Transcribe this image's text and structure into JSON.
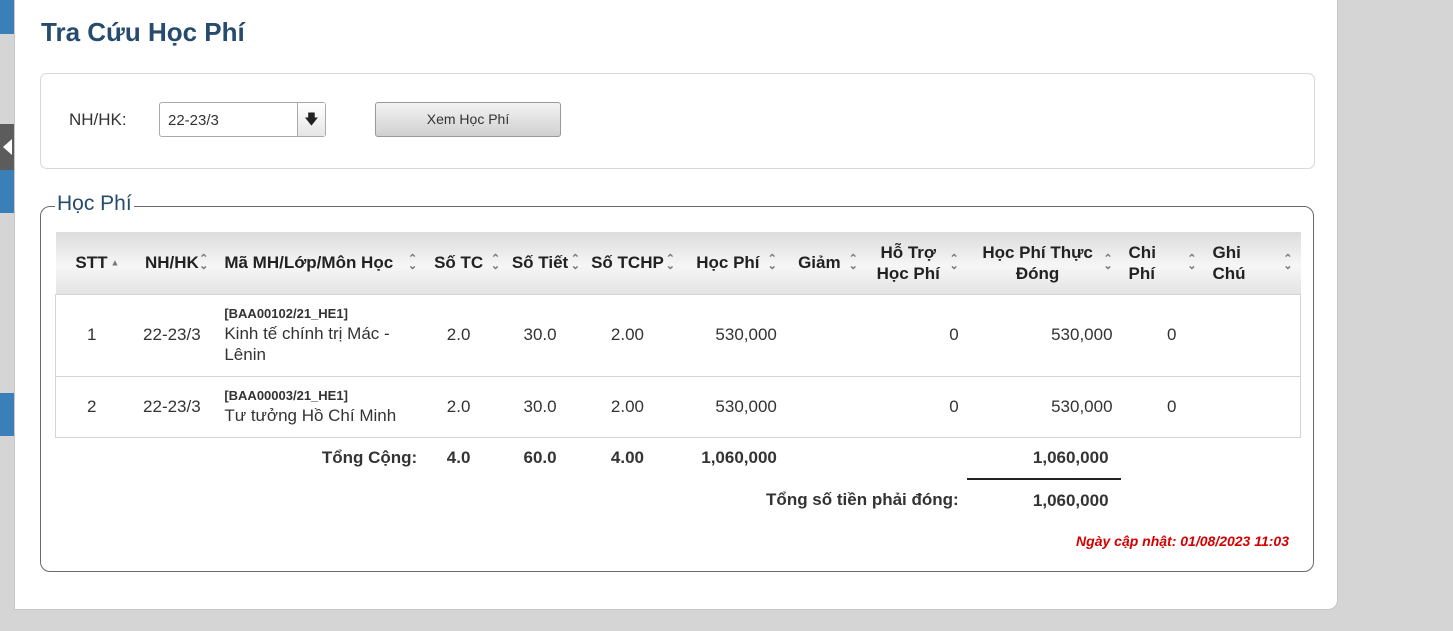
{
  "page": {
    "title": "Tra Cứu Học Phí"
  },
  "filter": {
    "term_label": "NH/HK:",
    "term_value": "22-23/3",
    "view_button_label": "Xem Học Phí"
  },
  "fees": {
    "legend": "Học Phí",
    "columns": [
      {
        "label": "STT",
        "sort": "▲"
      },
      {
        "label": "NH/HK",
        "sort": "⌃⌄"
      },
      {
        "label": "Mã MH/Lớp/Môn Học",
        "sort": "⌃⌄"
      },
      {
        "label": "Số TC",
        "sort": "⌃⌄"
      },
      {
        "label": "Số Tiết",
        "sort": "⌃⌄"
      },
      {
        "label": "Số TCHP",
        "sort": "⌃⌄"
      },
      {
        "label": "Học Phí",
        "sort": "⌃⌄"
      },
      {
        "label": "Giảm",
        "sort": "⌃⌄"
      },
      {
        "label": "Hỗ Trợ Học Phí",
        "sort": "⌃⌄"
      },
      {
        "label": "Học Phí Thực Đóng",
        "sort": "⌃⌄"
      },
      {
        "label": "Chi Phí",
        "sort": "⌃⌄"
      },
      {
        "label": "Ghi Chú",
        "sort": "⌃⌄"
      }
    ],
    "rows": [
      {
        "stt": "1",
        "term": "22-23/3",
        "code": "[BAA00102/21_HE1]",
        "subject": "Kinh tế chính trị Mác - Lênin",
        "credits": "2.0",
        "periods": "30.0",
        "fee_credits": "2.00",
        "fee": "530,000",
        "discount": "",
        "support": "0",
        "actual_fee": "530,000",
        "cost": "0",
        "note": ""
      },
      {
        "stt": "2",
        "term": "22-23/3",
        "code": "[BAA00003/21_HE1]",
        "subject": "Tư tưởng Hồ Chí Minh",
        "credits": "2.0",
        "periods": "30.0",
        "fee_credits": "2.00",
        "fee": "530,000",
        "discount": "",
        "support": "0",
        "actual_fee": "530,000",
        "cost": "0",
        "note": ""
      }
    ],
    "total": {
      "label": "Tổng Cộng:",
      "credits": "4.0",
      "periods": "60.0",
      "fee_credits": "4.00",
      "fee": "1,060,000",
      "actual_fee": "1,060,000"
    },
    "payable": {
      "label": "Tổng số tiền phải đóng:",
      "value": "1,060,000"
    },
    "updated": "Ngày cập nhật: 01/08/2023 11:03"
  },
  "colors": {
    "title": "#264b6c",
    "updated": "#d40000",
    "edge_tab": "#3a7fb8"
  }
}
